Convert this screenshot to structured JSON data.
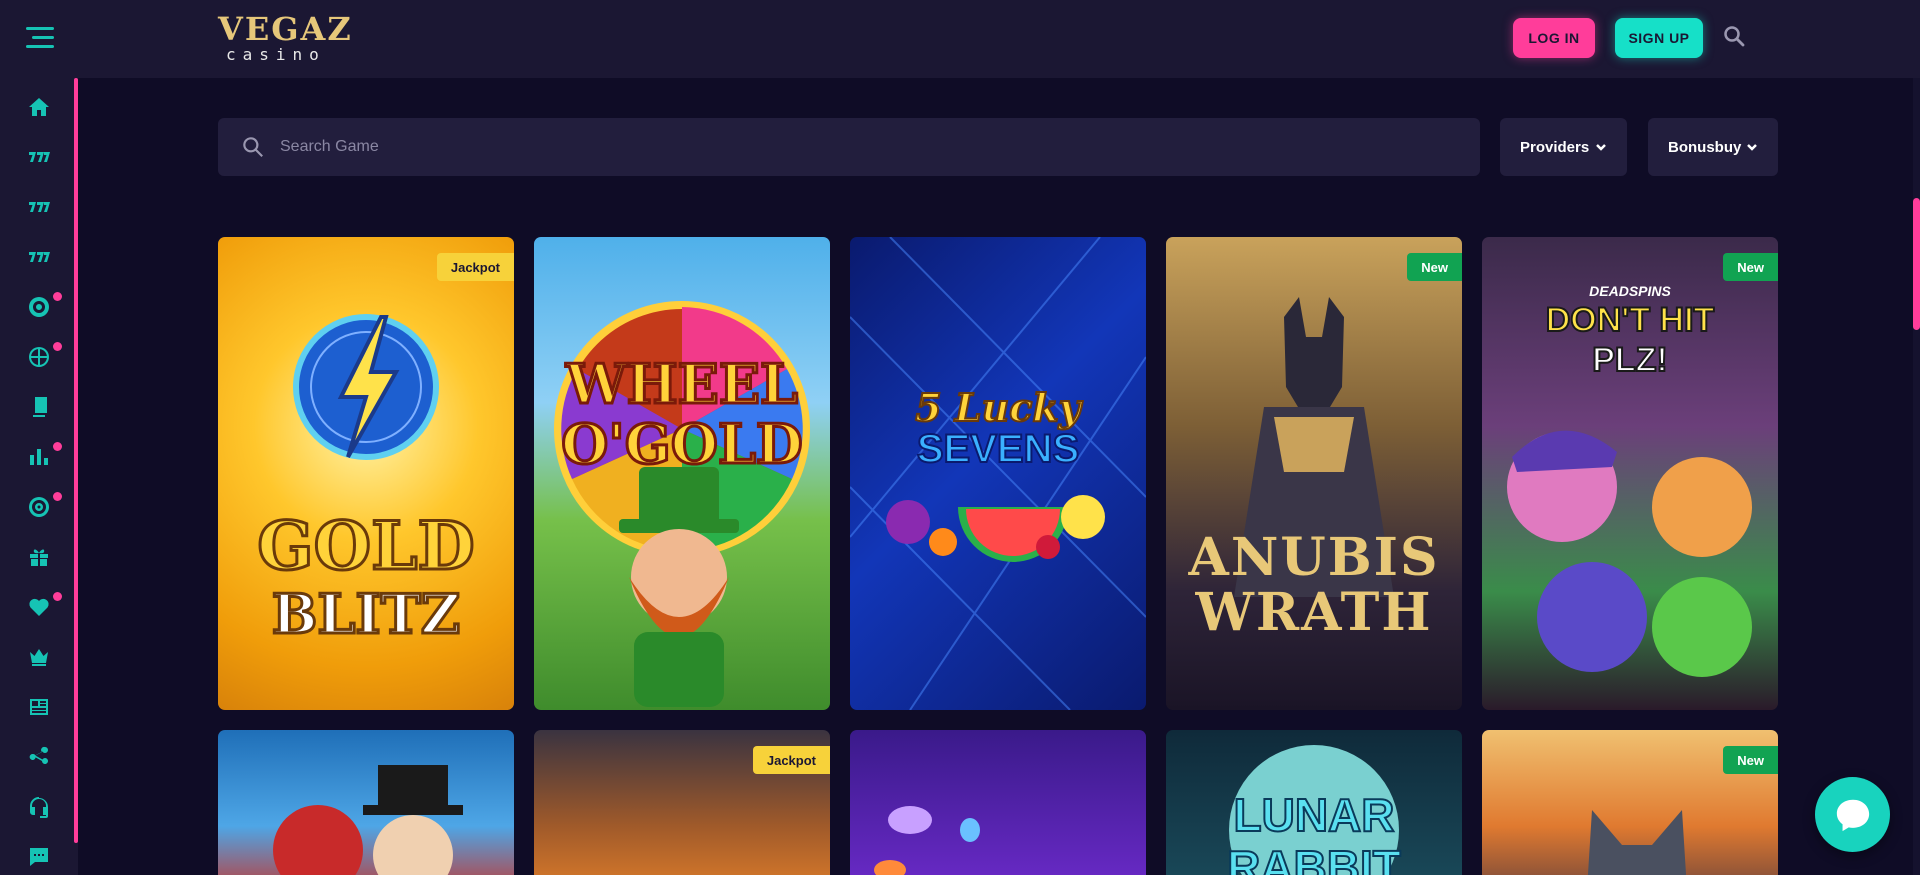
{
  "brand": {
    "logo_top": "VEGAZ",
    "logo_bottom": "casino"
  },
  "header": {
    "login_label": "LOG IN",
    "signup_label": "SIGN UP"
  },
  "search": {
    "placeholder": "Search Game"
  },
  "filters": {
    "providers_label": "Providers",
    "bonusbuy_label": "Bonusbuy"
  },
  "sidebar": {
    "items": [
      {
        "icon": "home-icon",
        "dot": false
      },
      {
        "icon": "slots-777-icon",
        "dot": false
      },
      {
        "icon": "slots-777-icon",
        "dot": false
      },
      {
        "icon": "slots-777-icon",
        "dot": false
      },
      {
        "icon": "casino-chip-icon",
        "dot": true
      },
      {
        "icon": "basketball-icon",
        "dot": true
      },
      {
        "icon": "cards-icon",
        "dot": false
      },
      {
        "icon": "bar-chart-icon",
        "dot": true
      },
      {
        "icon": "target-icon",
        "dot": true
      },
      {
        "icon": "gift-icon",
        "dot": false
      },
      {
        "icon": "heart-icon",
        "dot": true
      },
      {
        "icon": "crown-icon",
        "dot": false
      },
      {
        "icon": "newspaper-icon",
        "dot": false
      },
      {
        "icon": "share-network-icon",
        "dot": false
      },
      {
        "icon": "headset-icon",
        "dot": false
      },
      {
        "icon": "chat-icon",
        "dot": false
      }
    ]
  },
  "games": {
    "row1": [
      {
        "title_line1": "GOLD",
        "title_line2": "BLITZ",
        "badge": "Jackpot",
        "badge_type": "jackpot"
      },
      {
        "title_line1": "WHEEL",
        "title_line2": "O'GOLD",
        "badge": "",
        "badge_type": ""
      },
      {
        "title_line1": "5 Lucky",
        "title_line2": "SEVENS",
        "badge": "",
        "badge_type": ""
      },
      {
        "title_line1": "ANUBIS",
        "title_line2": "WRATH",
        "badge": "New",
        "badge_type": "new"
      },
      {
        "title_line0": "DEADSPINS",
        "title_line1": "DON'T HIT",
        "title_line2": "PLZ!",
        "badge": "New",
        "badge_type": "new"
      }
    ],
    "row2": [
      {
        "badge": "",
        "badge_type": ""
      },
      {
        "badge": "Jackpot",
        "badge_type": "jackpot"
      },
      {
        "badge": "",
        "badge_type": ""
      },
      {
        "title_line1": "LUNAR",
        "title_line2": "RABBIT",
        "badge": "",
        "badge_type": ""
      },
      {
        "badge": "New",
        "badge_type": "new"
      }
    ]
  },
  "colors": {
    "accent_pink": "#ff3d9a",
    "accent_teal": "#16e0c8",
    "background": "#0f0c26",
    "panel": "#1b1733"
  }
}
